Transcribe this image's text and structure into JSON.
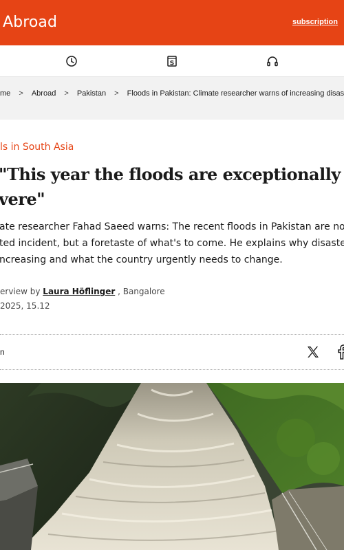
{
  "header": {
    "section": "Abroad",
    "subscription_label": "subscription",
    "brand_color": "#e64415"
  },
  "icons": [
    "clock-icon",
    "newspaper-s-icon",
    "headphones-icon"
  ],
  "breadcrumb": {
    "items": [
      "me",
      "Abroad",
      "Pakistan",
      "Floods in Pakistan: Climate researcher warns of increasing disasters"
    ],
    "separator": ">"
  },
  "article": {
    "kicker": "ls in South Asia",
    "headline_line1": "\"This year the floods are exceptionally",
    "headline_line2": "vere\"",
    "lead_line1": "ate researcher Fahad Saeed warns: The recent floods in Pakistan are not",
    "lead_line2": "ted incident, but a foretaste of what's to come. He explains why disasters",
    "lead_line3": "ncreasing and what the country urgently needs to change.",
    "byline_prefix": "erview by ",
    "author": "Laura Höflinger",
    "byline_suffix": " , Bangalore",
    "date": "2025, 15.12"
  },
  "share": {
    "label": "n",
    "icons": [
      "x-icon",
      "facebook-icon"
    ]
  },
  "image": {
    "subject": "dam-spillway-flood-water"
  }
}
